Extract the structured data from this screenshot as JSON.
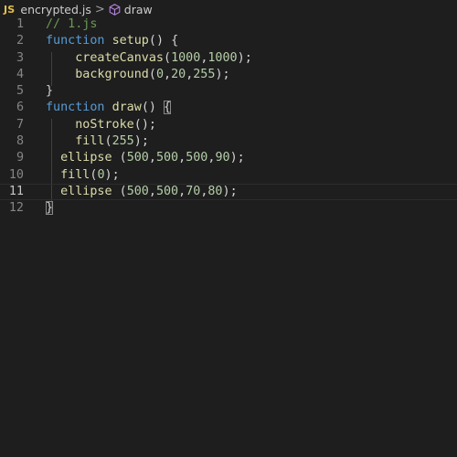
{
  "breadcrumb": {
    "file_badge": "JS",
    "file_name": "encrypted.js",
    "separator": ">",
    "symbol_icon": "cube-icon",
    "symbol_name": "draw"
  },
  "editor": {
    "current_line": 11,
    "lines": [
      {
        "number": "1",
        "text": "// 1.js"
      },
      {
        "number": "2",
        "text": "function setup() {"
      },
      {
        "number": "3",
        "text": "    createCanvas(1000,1000);"
      },
      {
        "number": "4",
        "text": "    background(0,20,255);"
      },
      {
        "number": "5",
        "text": "}"
      },
      {
        "number": "6",
        "text": "function draw() {"
      },
      {
        "number": "7",
        "text": "    noStroke();"
      },
      {
        "number": "8",
        "text": "    fill(255);"
      },
      {
        "number": "9",
        "text": "  ellipse (500,500,500,90);"
      },
      {
        "number": "10",
        "text": "  fill(0);"
      },
      {
        "number": "11",
        "text": "  ellipse (500,500,70,80);"
      },
      {
        "number": "12",
        "text": "}"
      }
    ]
  },
  "colors": {
    "background": "#1e1e1e",
    "keyword": "#569cd6",
    "function": "#dcdcaa",
    "number": "#b5cea8",
    "comment": "#6a9955",
    "punctuation": "#d4d4d4",
    "line_number": "#858585",
    "js_badge": "#e2c04a",
    "symbol_icon": "#b180d7"
  }
}
